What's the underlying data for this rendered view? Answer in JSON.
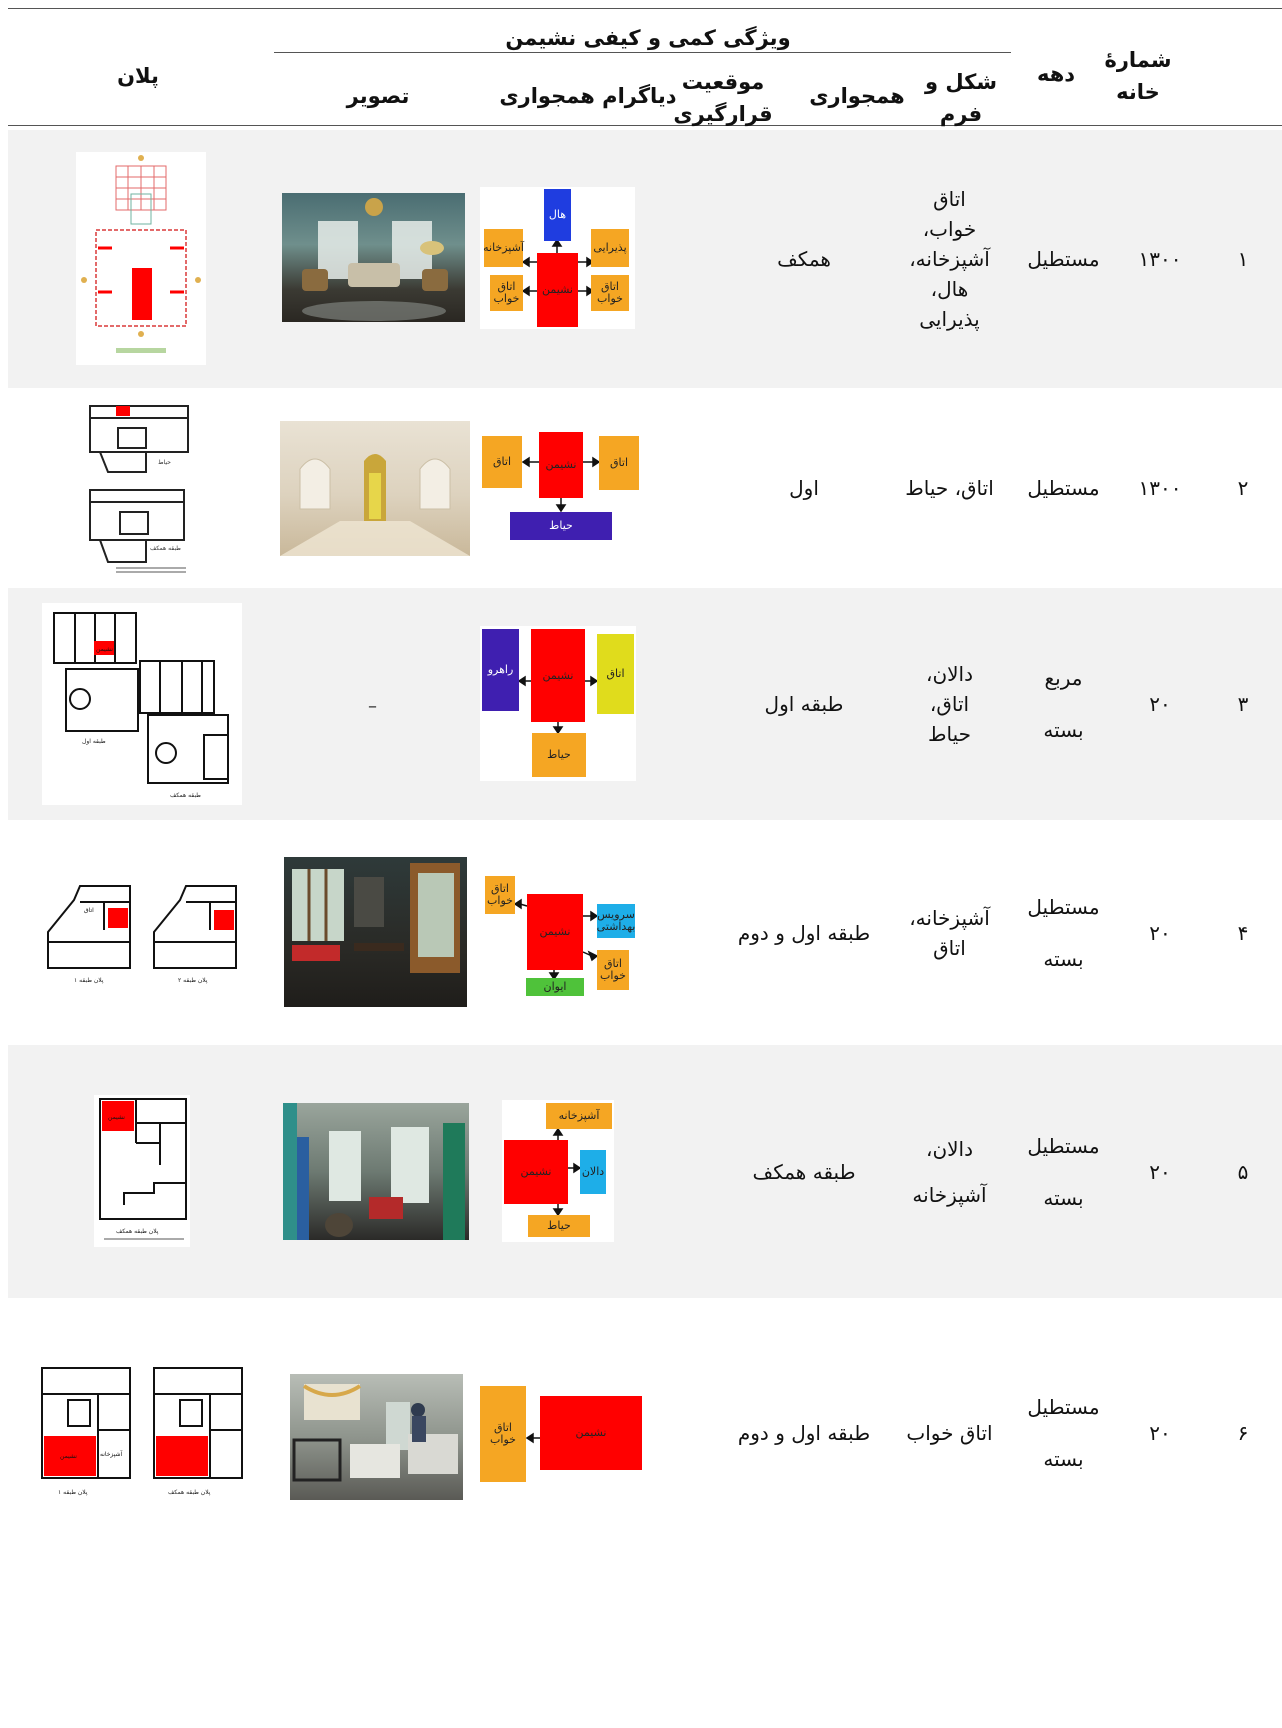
{
  "header": {
    "group_title": "ویژگی کمی و کیفی نشیمن",
    "col_plan": "پلان",
    "col_image": "تصویر",
    "col_diagram": "دیاگرام همجواری",
    "col_position": "موقعیت قرارگیری",
    "col_adjacency": "همجواری",
    "col_shape": "شکل و فرم",
    "col_decade": "دهه",
    "col_house": "شمارۀ خانه"
  },
  "colors": {
    "living": "#ff0000",
    "orange": "#f5a623",
    "blue": "#1f3de0",
    "purple": "#3f1fb0",
    "yellow": "#e0dc1c",
    "cyan": "#1eaee8",
    "green": "#4fc23a",
    "shade": "#f2f2f2"
  },
  "rows": [
    {
      "num": "۱",
      "decade": "۱۳۰۰",
      "shape": "مستطیل",
      "adjacency": "اتاق خواب، آشپزخانه، هال، پذیرایی",
      "position": "همکف",
      "image_dash": "",
      "diagram": {
        "living": "نشیمن",
        "top": "هال",
        "left_top": "آشپزخانه",
        "left_bottom": "اتاق خواب",
        "right_top": "پذیرایی",
        "right_bottom": "اتاق خواب"
      }
    },
    {
      "num": "۲",
      "decade": "۱۳۰۰",
      "shape": "مستطیل",
      "adjacency": "اتاق، حیاط",
      "position": "اول",
      "image_dash": "",
      "diagram": {
        "living": "نشیمن",
        "left": "اتاق",
        "right": "اتاق",
        "bottom": "حیاط"
      },
      "plan_labels": [
        "حیاط",
        "طبقه همکف"
      ]
    },
    {
      "num": "۳",
      "decade": "۲۰",
      "shape": "مربع بسته",
      "adjacency": "دالان، اتاق، حیاط",
      "position": "طبقه اول",
      "image_dash": "–",
      "diagram": {
        "living": "نشیمن",
        "left": "راهرو",
        "right": "اتاق",
        "bottom": "حیاط"
      },
      "plan_labels": [
        "نشیمن",
        "طبقه اول",
        "طبقه همکف"
      ]
    },
    {
      "num": "۴",
      "decade": "۲۰",
      "shape": "مستطیل بسته",
      "adjacency": "آشپزخانه، اتاق",
      "position": "طبقه اول و دوم",
      "image_dash": "",
      "diagram": {
        "living": "نشیمن",
        "left_top": "اتاق خواب",
        "right_top": "سرویس بهداشتی",
        "right_bottom": "اتاق خواب",
        "bottom": "ایوان"
      },
      "plan_labels": [
        "اتاق",
        "پلان طبقه ۱",
        "پلان طبقه ۲"
      ]
    },
    {
      "num": "۵",
      "decade": "۲۰",
      "shape": "مستطیل بسته",
      "adjacency": "دالان، آشپزخانه",
      "position": "طبقه همکف",
      "image_dash": "",
      "diagram": {
        "living": "نشیمن",
        "top": "آشپزخانه",
        "right": "دالان",
        "bottom": "حیاط"
      },
      "plan_labels": [
        "نشیمن",
        "پلان طبقه همکف"
      ]
    },
    {
      "num": "۶",
      "decade": "۲۰",
      "shape": "مستطیل بسته",
      "adjacency": "اتاق خواب",
      "position": "طبقه اول و دوم",
      "image_dash": "",
      "diagram": {
        "living": "نشیمن",
        "left": "اتاق خواب"
      },
      "plan_labels": [
        "نشیمن",
        "آشپزخانه",
        "پلان طبقه ۱",
        "پلان طبقه همکف"
      ]
    }
  ]
}
